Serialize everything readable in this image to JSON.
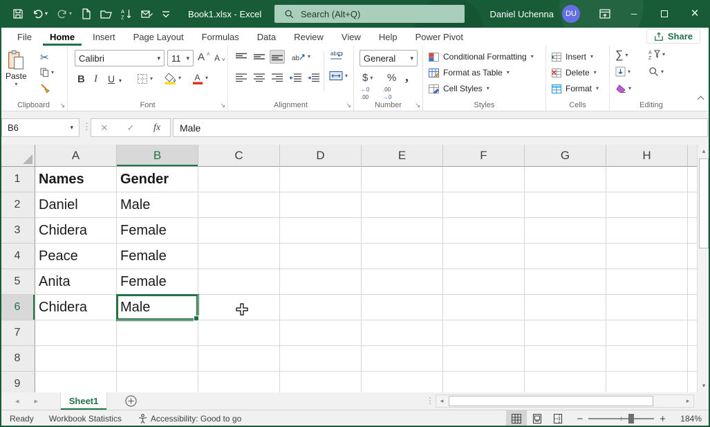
{
  "colors": {
    "titlebar_green": "#185C37",
    "accent_green": "#217346",
    "search_pill": "#A9CEBB",
    "avatar_blue": "#6470E4",
    "font_color_red": "#E0301E",
    "highlight_yellow": "#FFE600"
  },
  "titlebar": {
    "title": "Book1.xlsx - Excel",
    "search_placeholder": "Search (Alt+Q)",
    "user_name": "Daniel Uchenna",
    "user_initials": "DU",
    "qat_icons": [
      "save",
      "undo",
      "redo",
      "new-file",
      "open-folder",
      "sort-ascending",
      "email",
      "customize-quick-access-toolbar"
    ],
    "window_icons": [
      "ribbon-display-options",
      "minimize",
      "maximize",
      "close"
    ]
  },
  "tabs": {
    "items": [
      {
        "label": "File",
        "active": false
      },
      {
        "label": "Home",
        "active": true
      },
      {
        "label": "Insert",
        "active": false
      },
      {
        "label": "Page Layout",
        "active": false
      },
      {
        "label": "Formulas",
        "active": false
      },
      {
        "label": "Data",
        "active": false
      },
      {
        "label": "Review",
        "active": false
      },
      {
        "label": "View",
        "active": false
      },
      {
        "label": "Help",
        "active": false
      },
      {
        "label": "Power Pivot",
        "active": false
      }
    ],
    "share": "Share"
  },
  "ribbon": {
    "clipboard": {
      "label": "Clipboard",
      "paste": "Paste"
    },
    "font": {
      "label": "Font",
      "family": "Calibri",
      "size": "11",
      "bold": "B",
      "italic": "I",
      "underline": "U"
    },
    "alignment": {
      "label": "Alignment"
    },
    "number": {
      "label": "Number",
      "format": "General"
    },
    "styles": {
      "label": "Styles",
      "items": [
        "Conditional Formatting",
        "Format as Table",
        "Cell Styles"
      ]
    },
    "cells": {
      "label": "Cells",
      "items": [
        "Insert",
        "Delete",
        "Format"
      ]
    },
    "editing": {
      "label": "Editing"
    }
  },
  "formula_bar": {
    "name_box": "B6",
    "insert_function": "fx",
    "value": "Male"
  },
  "sheet": {
    "columns": [
      "A",
      "B",
      "C",
      "D",
      "E",
      "F",
      "G",
      "H"
    ],
    "rows": [
      {
        "n": "1",
        "bold": true,
        "cells": [
          "Names",
          "Gender",
          "",
          "",
          "",
          "",
          "",
          ""
        ]
      },
      {
        "n": "2",
        "cells": [
          "Daniel",
          "Male",
          "",
          "",
          "",
          "",
          "",
          ""
        ]
      },
      {
        "n": "3",
        "cells": [
          "Chidera",
          "Female",
          "",
          "",
          "",
          "",
          "",
          ""
        ]
      },
      {
        "n": "4",
        "cells": [
          "Peace",
          "Female",
          "",
          "",
          "",
          "",
          "",
          ""
        ]
      },
      {
        "n": "5",
        "cells": [
          "Anita",
          "Female",
          "",
          "",
          "",
          "",
          "",
          ""
        ]
      },
      {
        "n": "6",
        "cells": [
          "Chidera",
          "Male",
          "",
          "",
          "",
          "",
          "",
          ""
        ]
      },
      {
        "n": "7",
        "cells": [
          "",
          "",
          "",
          "",
          "",
          "",
          "",
          ""
        ]
      },
      {
        "n": "8",
        "cells": [
          "",
          "",
          "",
          "",
          "",
          "",
          "",
          ""
        ]
      },
      {
        "n": "9",
        "cells": [
          "",
          "",
          "",
          "",
          "",
          "",
          "",
          ""
        ]
      }
    ],
    "selection": {
      "cell": "B6",
      "column": "B",
      "row": "6"
    }
  },
  "sheet_tabs": {
    "active": "Sheet1"
  },
  "status_bar": {
    "mode": "Ready",
    "workbook_statistics": "Workbook Statistics",
    "accessibility": "Accessibility: Good to go",
    "zoom_level": "184%"
  }
}
